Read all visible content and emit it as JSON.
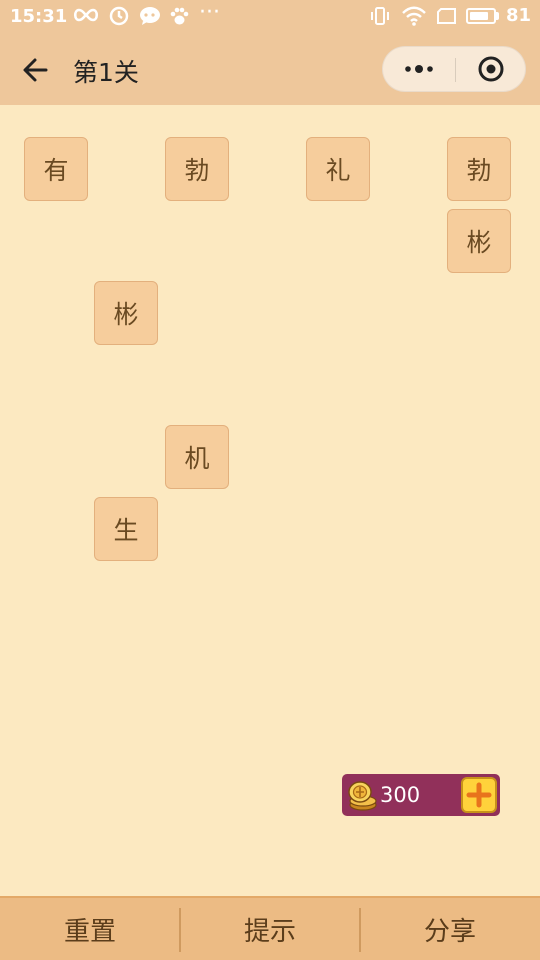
{
  "status_bar": {
    "time": "15:31",
    "icons": [
      "infinity-icon",
      "clock-icon",
      "chat-icon",
      "paw-icon",
      "more-dots-icon",
      "vibrate-icon",
      "wifi-icon",
      "screen-icon"
    ],
    "overflow_text": "···",
    "battery_level": "81",
    "battery_fraction": 0.81
  },
  "nav": {
    "title": "第1关",
    "back_icon": "arrow-left-icon",
    "more_icon": "more-icon",
    "close_icon": "target-circle-icon"
  },
  "tiles": [
    {
      "char": "有"
    },
    {
      "char": "勃"
    },
    {
      "char": "礼"
    },
    {
      "char": "勃"
    },
    {
      "char": "彬"
    },
    {
      "char": "彬"
    },
    {
      "char": "机"
    },
    {
      "char": "生"
    }
  ],
  "coins": {
    "count": "300",
    "icon": "coin-stack-icon",
    "add_icon": "plus-icon"
  },
  "bottom": {
    "reset_label": "重置",
    "hint_label": "提示",
    "share_label": "分享"
  },
  "colors": {
    "background": "#fce9c1",
    "header": "#eec79b",
    "tile": "#f6cd9c",
    "coin_bar": "#91305a",
    "bottom_bar": "#ecbb84"
  }
}
